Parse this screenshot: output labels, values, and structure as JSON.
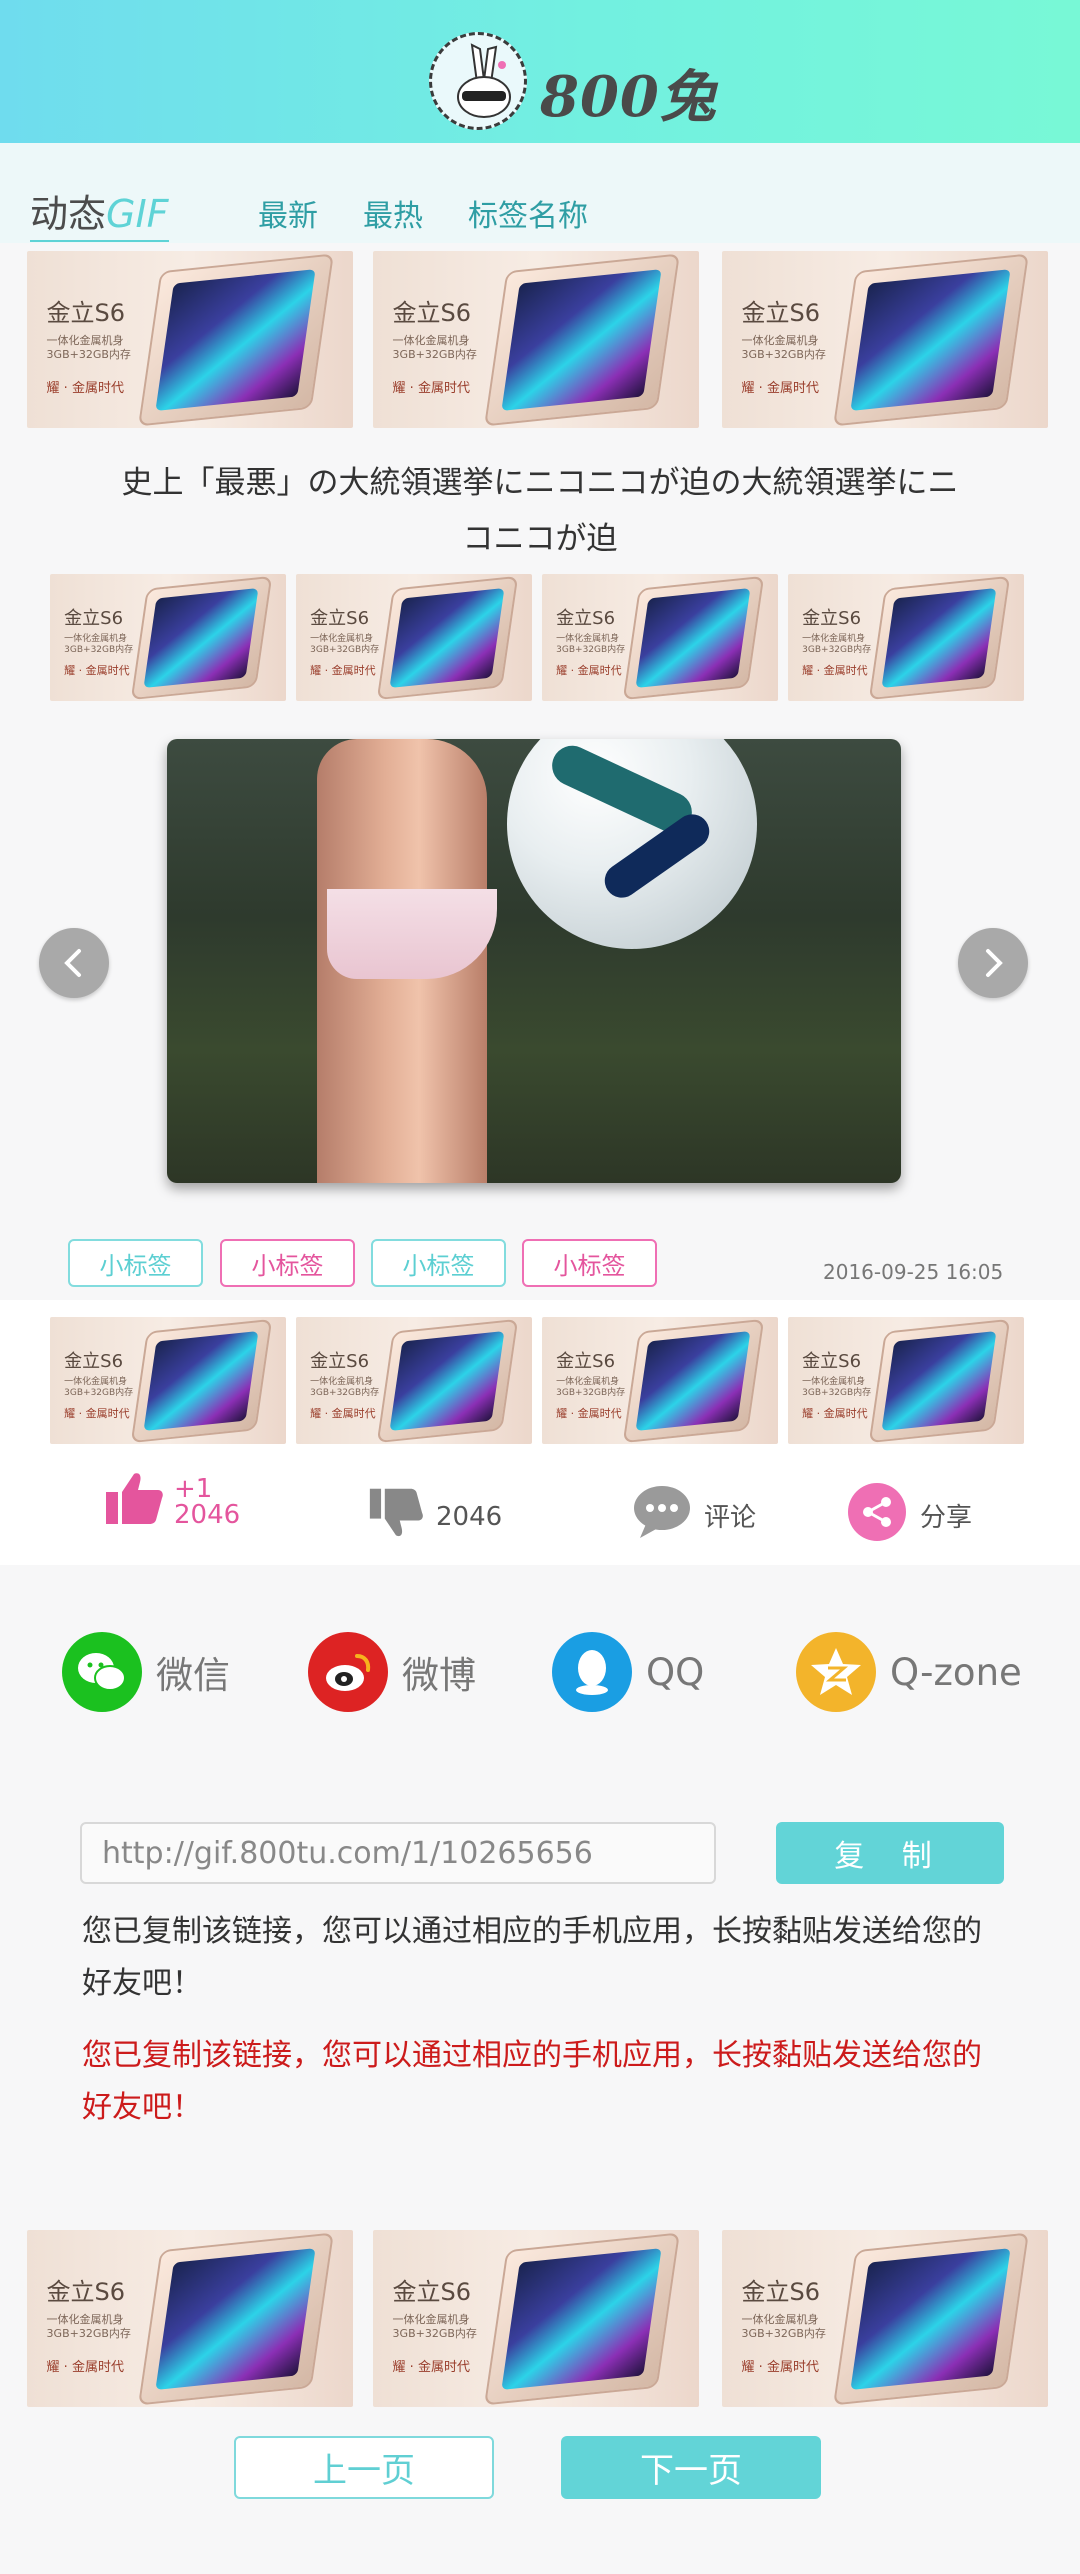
{
  "header": {
    "logo_text": "800兔"
  },
  "nav": {
    "title_prefix": "动态",
    "title_suffix": "GIF",
    "links": [
      "最新",
      "最热",
      "标签名称"
    ]
  },
  "ad": {
    "title": "金立S6",
    "sub1": "一体化金属机身",
    "sub2": "3GB+32GB内存",
    "brand": "耀 · 金属时代"
  },
  "headline": "史上「最悪」の大統領選挙にニコニコが迫の大統領選挙にニコニコが迫",
  "tags": [
    "小标签",
    "小标签",
    "小标签",
    "小标签"
  ],
  "date": "2016-09-25 16:05",
  "actions": {
    "like_plus": "+1",
    "like_count": "2046",
    "dislike_count": "2046",
    "comment": "评论",
    "share": "分享"
  },
  "share_targets": [
    "微信",
    "微博",
    "QQ",
    "Q-zone"
  ],
  "copy": {
    "url": "http://gif.800tu.com/1/10265656",
    "button": "复 制",
    "message": "您已复制该链接，您可以通过相应的手机应用，长按黏贴发送给您的好友吧！",
    "message_red": "您已复制该链接，您可以通过相应的手机应用，长按黏贴发送给您的好友吧！"
  },
  "pager": {
    "prev": "上一页",
    "next": "下一页"
  },
  "colors": {
    "accent": "#62d4d7",
    "pink": "#e4559d",
    "red": "#cc1b1b"
  }
}
